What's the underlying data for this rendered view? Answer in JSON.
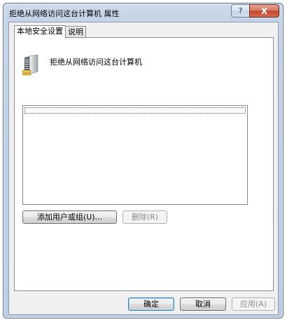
{
  "window": {
    "title": "拒绝从网络访问这台计算机 属性",
    "help_label": "?",
    "close_label": "X"
  },
  "tabs": [
    {
      "label": "本地安全设置",
      "active": true
    },
    {
      "label": "说明",
      "active": false
    }
  ],
  "page": {
    "icon": "server-icon",
    "heading": "拒绝从网络访问这台计算机",
    "list_items": []
  },
  "actions": {
    "add_label": "添加用户或组(U)...",
    "remove_label": "删除(R)"
  },
  "footer": {
    "ok_label": "确定",
    "cancel_label": "取消",
    "apply_label": "应用(A)"
  }
}
